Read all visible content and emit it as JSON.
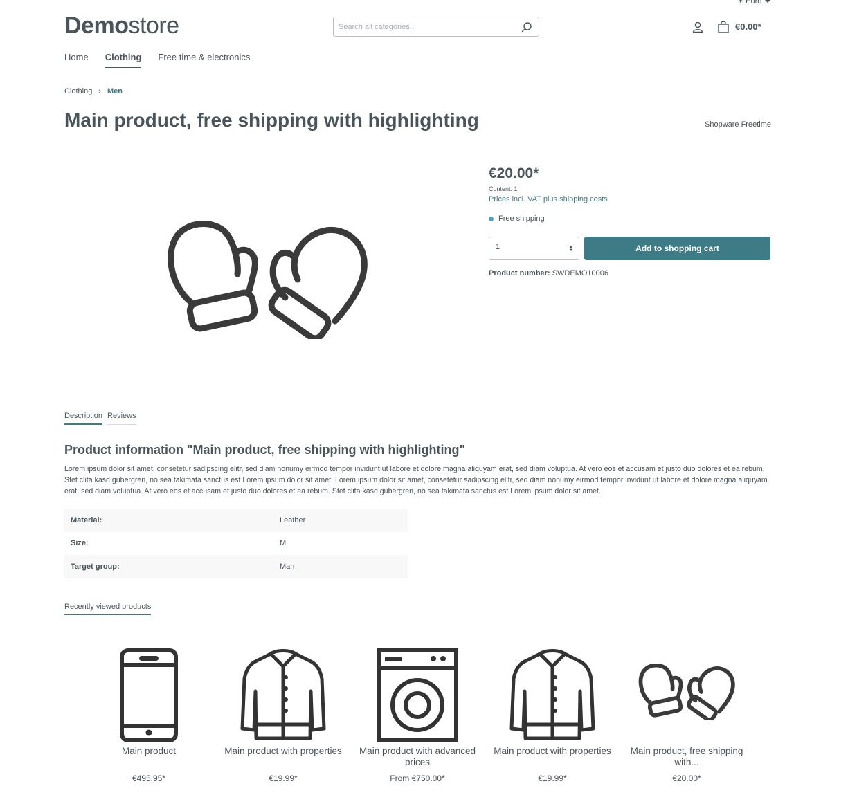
{
  "header": {
    "currency": "€ Euro",
    "logo_bold": "Demo",
    "logo_light": "store",
    "search_placeholder": "Search all categories...",
    "cart_total": "€0.00*"
  },
  "nav": {
    "items": [
      {
        "label": "Home",
        "active": false
      },
      {
        "label": "Clothing",
        "active": true
      },
      {
        "label": "Free time & electronics",
        "active": false
      }
    ]
  },
  "breadcrumb": {
    "items": [
      "Clothing",
      "Men"
    ]
  },
  "product": {
    "title": "Main product, free shipping with highlighting",
    "manufacturer": "Shopware Freetime",
    "price": "€20.00*",
    "content": "Content: 1",
    "tax_note": "Prices incl. VAT plus shipping costs",
    "shipping": "Free shipping",
    "quantity": "1",
    "add_to_cart": "Add to shopping cart",
    "product_number_label": "Product number:",
    "product_number": "SWDEMO10006"
  },
  "tabs": {
    "items": [
      "Description",
      "Reviews"
    ]
  },
  "description": {
    "heading": "Product information \"Main product, free shipping with highlighting\"",
    "text": "Lorem ipsum dolor sit amet, consetetur sadipscing elitr, sed diam nonumy eirmod tempor invidunt ut labore et dolore magna aliquyam erat, sed diam voluptua. At vero eos et accusam et justo duo dolores et ea rebum. Stet clita kasd gubergren, no sea takimata sanctus est Lorem ipsum dolor sit amet. Lorem ipsum dolor sit amet, consetetur sadipscing elitr, sed diam nonumy eirmod tempor invidunt ut labore et dolore magna aliquyam erat, sed diam voluptua. At vero eos et accusam et justo duo dolores et ea rebum. Stet clita kasd gubergren, no sea takimata sanctus est Lorem ipsum dolor sit amet.",
    "properties": [
      {
        "key": "Material:",
        "value": "Leather"
      },
      {
        "key": "Size:",
        "value": "M"
      },
      {
        "key": "Target group:",
        "value": "Man"
      }
    ]
  },
  "recent": {
    "tab_label": "Recently viewed products",
    "products": [
      {
        "name": "Main product",
        "price": "€495.95*",
        "icon": "smartphone-icon"
      },
      {
        "name": "Main product with properties",
        "price": "€19.99*",
        "icon": "shirt-icon"
      },
      {
        "name": "Main product with advanced prices",
        "price": "From €750.00*",
        "icon": "washing-machine-icon"
      },
      {
        "name": "Main product with properties",
        "price": "€19.99*",
        "icon": "shirt-icon"
      },
      {
        "name": "Main product, free shipping with...",
        "price": "€20.00*",
        "icon": "mittens-icon"
      }
    ]
  },
  "colors": {
    "accent": "#3d7b87",
    "text": "#4a545b",
    "link": "#3f7a87",
    "shipping_dot": "#4aa3c9"
  }
}
